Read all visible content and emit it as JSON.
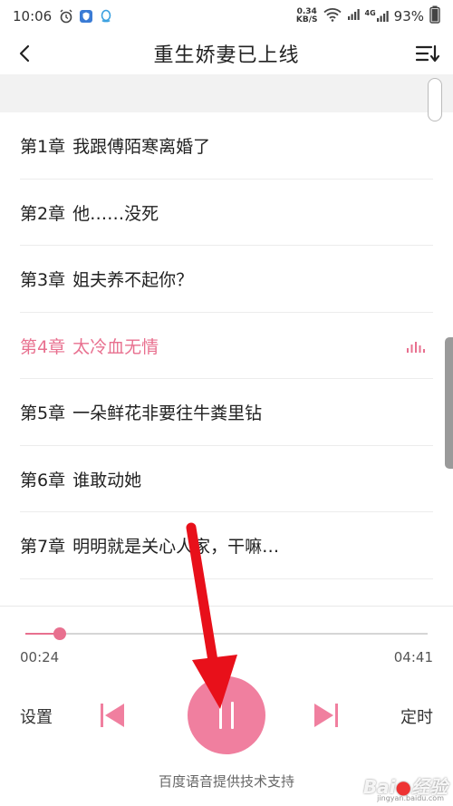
{
  "status_bar": {
    "time": "10:06",
    "net_speed_value": "0.34",
    "net_speed_unit": "KB/S",
    "network": "4G",
    "battery": "93%"
  },
  "header": {
    "title": "重生娇妻已上线"
  },
  "chapters": [
    {
      "num": "第1章",
      "title": "我跟傅陌寒离婚了",
      "active": false
    },
    {
      "num": "第2章",
      "title": "他……没死",
      "active": false
    },
    {
      "num": "第3章",
      "title": "姐夫养不起你？",
      "active": false
    },
    {
      "num": "第4章",
      "title": "太冷血无情",
      "active": true
    },
    {
      "num": "第5章",
      "title": "一朵鲜花非要往牛粪里钻",
      "active": false
    },
    {
      "num": "第6章",
      "title": "谁敢动她",
      "active": false
    },
    {
      "num": "第7章",
      "title": "明明就是关心人家，干嘛…",
      "active": false
    }
  ],
  "player": {
    "current_time": "00:24",
    "total_time": "04:41",
    "progress": 0.085,
    "settings_label": "设置",
    "timer_label": "定时",
    "state": "playing"
  },
  "footer": {
    "credit": "百度语音提供技术支持"
  },
  "watermark": {
    "logo": "Bai du 经验",
    "url": "jingyan.baidu.com"
  },
  "colors": {
    "accent": "#e8708f",
    "play_button": "#f07f9f",
    "annotation_arrow": "#e8101a"
  }
}
